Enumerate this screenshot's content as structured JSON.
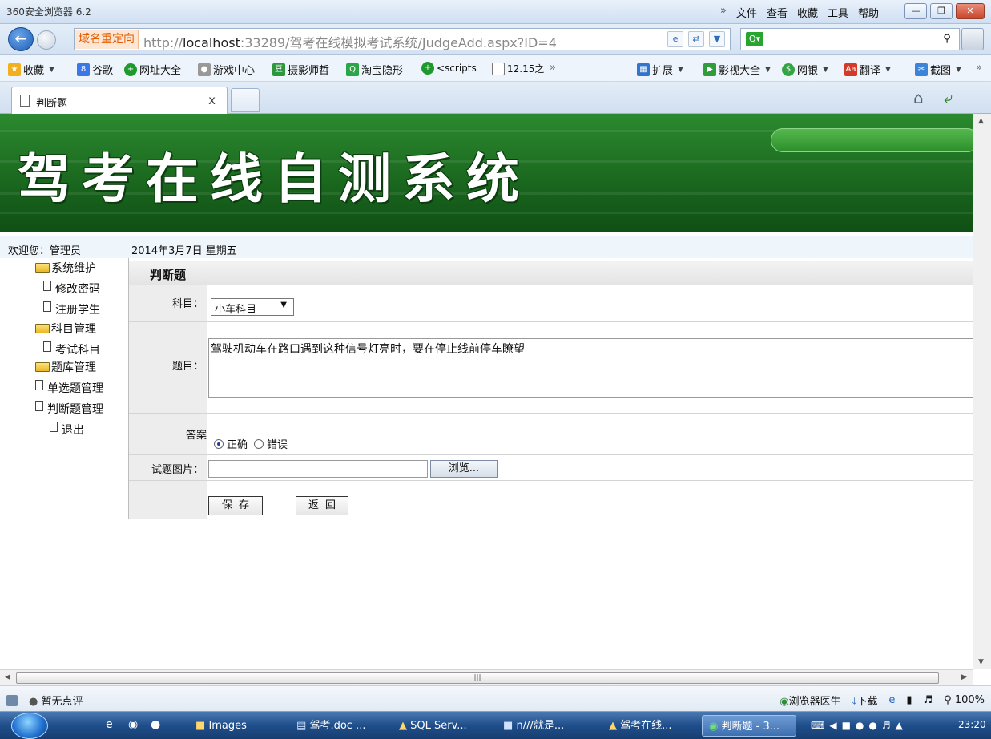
{
  "browser": {
    "title": "360安全浏览器 6.2",
    "menu": [
      "»",
      "文件",
      "查看",
      "收藏",
      "工具",
      "帮助"
    ],
    "redirect_tag": "域名重定向",
    "url_prefix": "http://",
    "url_host": "localhost",
    "url_rest": ":33289/驾考在线模拟考试系统/JudgeAdd.aspx?ID=4",
    "favorites": [
      {
        "label": "收藏",
        "icon": "star-icon"
      },
      {
        "label": "谷歌",
        "icon": "google-icon"
      },
      {
        "label": "网址大全",
        "icon": "site-nav-icon"
      },
      {
        "label": "游戏中心",
        "icon": "gamepad-icon"
      },
      {
        "label": "摄影师哲",
        "icon": "douban-icon"
      },
      {
        "label": "淘宝隐形",
        "icon": "search-icon"
      },
      {
        "label": "<scripts",
        "icon": "site-nav-icon"
      },
      {
        "label": "12.15之",
        "icon": "page-icon"
      }
    ],
    "fav_overflow": "»",
    "extensions": [
      "扩展",
      "影视大全",
      "网银",
      "翻译",
      "截图"
    ],
    "tab_label": "判断题",
    "tab_close": "x"
  },
  "page": {
    "banner_title": "驾考在线自测系统",
    "welcome": "欢迎您：管理员",
    "date": "2014年3月7日 星期五",
    "tree": [
      {
        "label": "系统维护",
        "type": "folder"
      },
      {
        "label": "修改密码",
        "type": "doc"
      },
      {
        "label": "注册学生",
        "type": "doc"
      },
      {
        "label": "科目管理",
        "type": "folder"
      },
      {
        "label": "考试科目",
        "type": "doc"
      },
      {
        "label": "题库管理",
        "type": "folder"
      },
      {
        "label": "单选题管理",
        "type": "doc"
      },
      {
        "label": "判断题管理",
        "type": "doc"
      },
      {
        "label": "退出",
        "type": "doc"
      }
    ],
    "form": {
      "header": "判断题",
      "subject_label": "科目：",
      "subject_value": "小车科目",
      "question_label": "题目：",
      "question_value": "驾驶机动车在路口遇到这种信号灯亮时，要在停止线前停车瞭望",
      "answer_label": "答案",
      "answer_options": [
        "正确",
        "错误"
      ],
      "answer_selected": "正确",
      "image_label": "试题图片：",
      "browse_label": "浏览...",
      "save_label": "保存",
      "back_label": "返回"
    }
  },
  "status": {
    "rating": "暂无点评",
    "doctor": "浏览器医生",
    "download": "下载",
    "zoom": "100%"
  },
  "taskbar": {
    "items": [
      "Images",
      "驾考.doc ...",
      "SQL Serv...",
      "n///就是...",
      "驾考在线...",
      "判断题 - 3..."
    ],
    "active_index": 5,
    "clock": "23:20"
  }
}
